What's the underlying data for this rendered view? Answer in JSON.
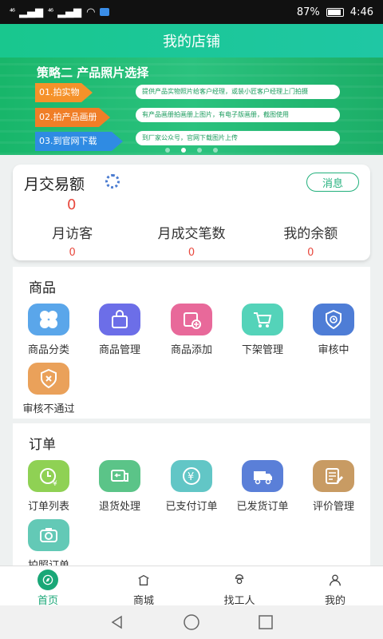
{
  "status_bar": {
    "signal_left": "⁴⁶",
    "signal_right": "⁴⁶",
    "battery": "87%",
    "time": "4:46"
  },
  "header": {
    "title": "我的店铺"
  },
  "banner": {
    "title": "策略二 产品照片选择",
    "tags": [
      "01.拍实物",
      "02.拍产品画册",
      "03.到官网下载"
    ],
    "notes": [
      "提供产品实物照片给客户经理，或装小匠客户经理上门拍摄",
      "有产品画册拍画册上图片，有电子版画册，截图使用",
      "到厂家公众号，官网下载图片上传"
    ]
  },
  "summary": {
    "title": "月交易额",
    "amount": "0",
    "message_button": "消息",
    "stats": [
      {
        "label": "月访客",
        "value": "0"
      },
      {
        "label": "月成交笔数",
        "value": "0"
      },
      {
        "label": "我的余额",
        "value": "0"
      }
    ]
  },
  "goods": {
    "title": "商品",
    "items": [
      {
        "label": "商品分类",
        "color": "#5aa6ea",
        "icon": "category-icon"
      },
      {
        "label": "商品管理",
        "color": "#6c6ee8",
        "icon": "shopping-bag-icon"
      },
      {
        "label": "商品添加",
        "color": "#e8699a",
        "icon": "add-product-icon"
      },
      {
        "label": "下架管理",
        "color": "#54d3b9",
        "icon": "cart-icon"
      },
      {
        "label": "审核中",
        "color": "#4e7dd6",
        "icon": "shield-clock-icon"
      },
      {
        "label": "审核不通过",
        "color": "#eaa15a",
        "icon": "shield-x-icon"
      }
    ]
  },
  "orders": {
    "title": "订单",
    "items": [
      {
        "label": "订单列表",
        "color": "#8fd154",
        "icon": "yen-clock-icon"
      },
      {
        "label": "退货处理",
        "color": "#5bc488",
        "icon": "return-truck-icon"
      },
      {
        "label": "已支付订单",
        "color": "#62c6c6",
        "icon": "paid-icon"
      },
      {
        "label": "已发货订单",
        "color": "#5a7fd8",
        "icon": "truck-icon"
      },
      {
        "label": "评价管理",
        "color": "#c89b63",
        "icon": "review-icon"
      },
      {
        "label": "拍照订单",
        "color": "#63c9b6",
        "icon": "camera-icon"
      }
    ]
  },
  "tabbar": {
    "tabs": [
      {
        "label": "首页",
        "icon": "compass-icon",
        "active": true
      },
      {
        "label": "商城",
        "icon": "store-icon"
      },
      {
        "label": "找工人",
        "icon": "worker-icon"
      },
      {
        "label": "我的",
        "icon": "user-icon"
      }
    ]
  }
}
